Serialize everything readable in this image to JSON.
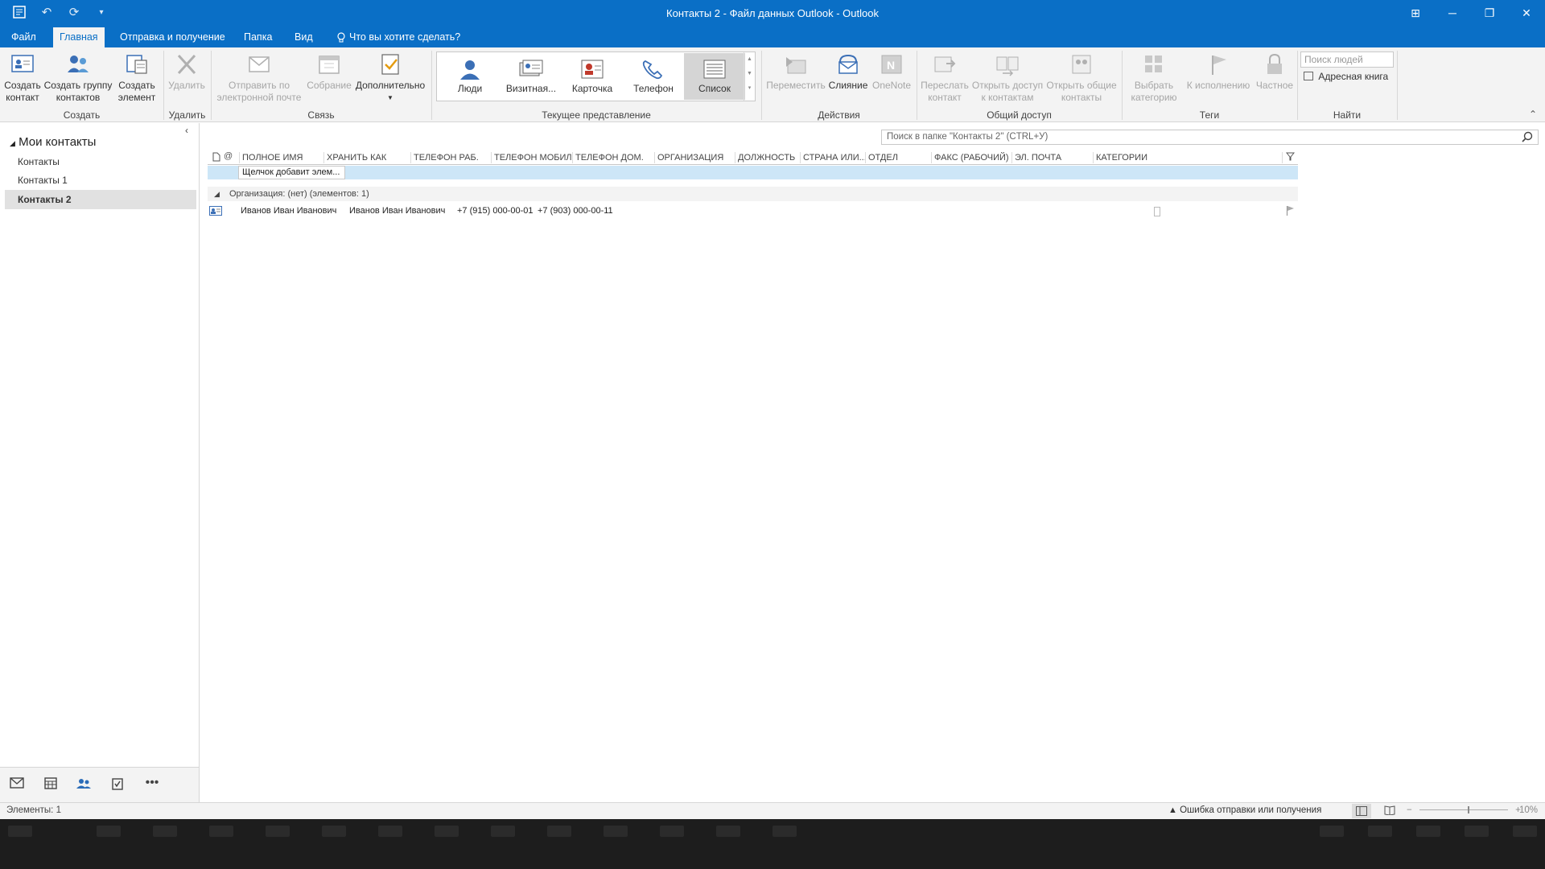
{
  "window": {
    "title": "Контакты 2 - Файл данных Outlook - Outlook",
    "controls": [
      "⊞",
      "─",
      "❐",
      "✕"
    ]
  },
  "tabs": [
    {
      "label": "Файл"
    },
    {
      "label": "Главная"
    },
    {
      "label": "Отправка и получение"
    },
    {
      "label": "Папка"
    },
    {
      "label": "Вид"
    },
    {
      "label": "Что вы хотите сделать?"
    }
  ],
  "ribbon": {
    "create_contact": "Создать\nконтакт",
    "create_group": "Создать группу\nконтактов",
    "create_item": "Создать\nэлемент",
    "delete": "Удалить",
    "send_email": "Отправить по\nэлектронной почте",
    "meeting": "Собрание",
    "more": "Дополнительно",
    "views": [
      "Люди",
      "Визитная...",
      "Карточка",
      "Телефон",
      "Список"
    ],
    "move": "Переместить",
    "merge": "Слияние",
    "onenote": "OneNote",
    "forward_contact": "Переслать\nконтакт",
    "share_contacts": "Открыть доступ\nк контактам",
    "open_shared": "Открыть общие\nконтакты",
    "categorize": "Выбрать\nкатегорию",
    "followup": "К исполнению",
    "private": "Частное",
    "search_people_placeholder": "Поиск людей",
    "address_book": "Адресная книга",
    "groups": {
      "create": "Создать",
      "delete": "Удалить",
      "communicate": "Связь",
      "current_view": "Текущее представление",
      "actions": "Действия",
      "share": "Общий доступ",
      "tags": "Теги",
      "find": "Найти"
    }
  },
  "nav": {
    "header": "Мои контакты",
    "items": [
      "Контакты",
      "Контакты 1",
      "Контакты 2"
    ],
    "selected": "Контакты 2"
  },
  "search": {
    "placeholder": "Поиск в папке \"Контакты 2\" (CTRL+У)"
  },
  "table": {
    "columns": [
      "ПОЛНОЕ ИМЯ",
      "ХРАНИТЬ КАК",
      "ТЕЛЕФОН РАБ.",
      "ТЕЛЕФОН МОБИЛЬН...",
      "ТЕЛЕФОН ДОМ.",
      "ОРГАНИЗАЦИЯ",
      "ДОЛЖНОСТЬ",
      "СТРАНА ИЛИ...",
      "ОТДЕЛ",
      "ФАКС (РАБОЧИЙ)",
      "ЭЛ. ПОЧТА",
      "КАТЕГОРИИ"
    ],
    "add_placeholder": "Щелчок добавит элем...",
    "group_label": "Организация: (нет) (элементов: 1)",
    "rows": [
      {
        "full_name": "Иванов Иван Иванович",
        "file_as": "Иванов Иван Иванович",
        "work_phone": "+7 (915) 000-00-01",
        "mobile_phone": "+7 (903) 000-00-11"
      }
    ]
  },
  "status": {
    "items": "Элементы: 1",
    "error": "Ошибка отправки или получения",
    "zoom": "10%"
  },
  "colors": {
    "accent": "#0a6fc6",
    "ribbon_bg": "#f3f3f3",
    "selection": "#cde6f7"
  }
}
